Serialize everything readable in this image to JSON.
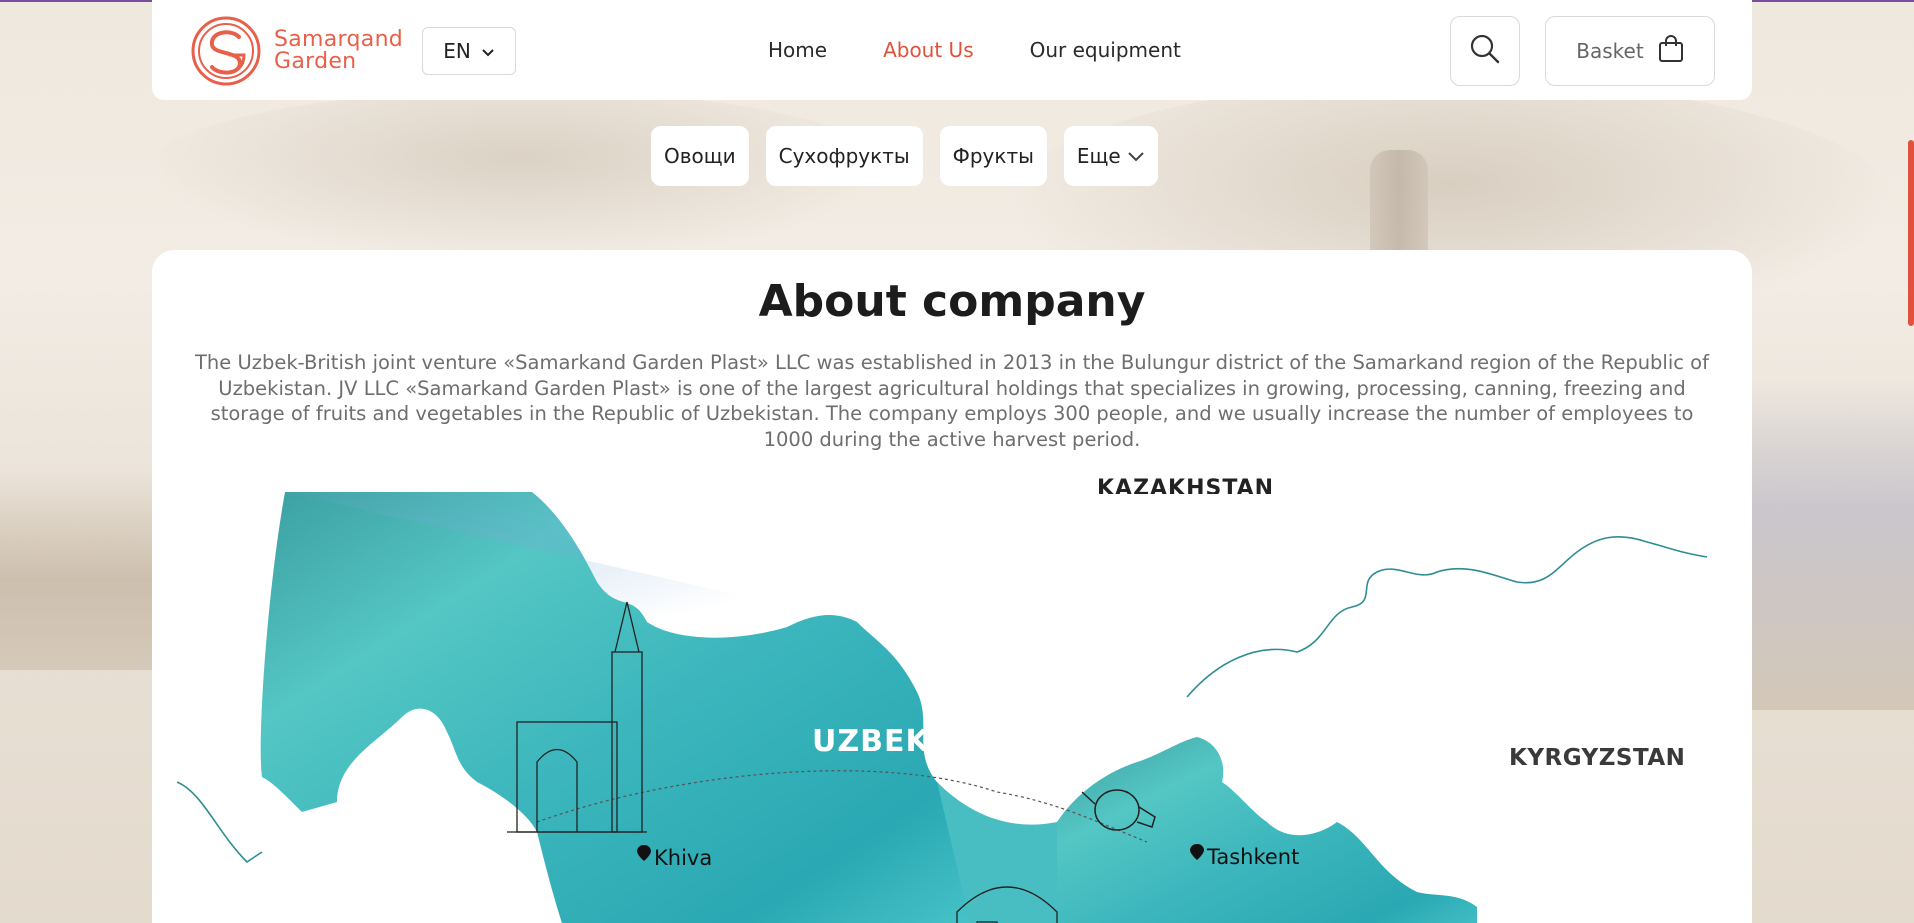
{
  "brand": {
    "name_line1": "Samarqand",
    "name_line2": "Garden",
    "color": "#e8604a"
  },
  "language": {
    "selected": "EN"
  },
  "nav": {
    "items": [
      {
        "label": "Home",
        "active": false
      },
      {
        "label": "About Us",
        "active": true
      },
      {
        "label": "Our equipment",
        "active": false
      }
    ]
  },
  "header_actions": {
    "basket_label": "Basket"
  },
  "categories": [
    {
      "label": "Овощи"
    },
    {
      "label": "Сухофрукты"
    },
    {
      "label": "Фрукты"
    },
    {
      "label": "Еще"
    }
  ],
  "about": {
    "title": "About company",
    "description": "The Uzbek-British joint venture «Samarkand Garden Plast» LLC was established in 2013 in the Bulungur district of the Samarkand region of the Republic of Uzbekistan. JV LLC «Samarkand Garden Plast» is one of the largest agricultural holdings that specializes in growing, processing, canning, freezing and storage of fruits and vegetables in the Republic of Uzbekistan. The company employs 300 people, and we usually increase the number of employees to 1000 during the active harvest period."
  },
  "map": {
    "country_label": "UZBEKISTAN",
    "neighbor_label": "KYRGYZSTAN",
    "top_label": "KAZAKHSTAN",
    "cities": [
      {
        "name": "Khiva"
      },
      {
        "name": "Tashkent"
      }
    ],
    "accent_color": "#3fc3c3"
  },
  "colors": {
    "accent": "#e0523c",
    "text": "#1c1c1c",
    "muted": "#6e6e6e"
  }
}
